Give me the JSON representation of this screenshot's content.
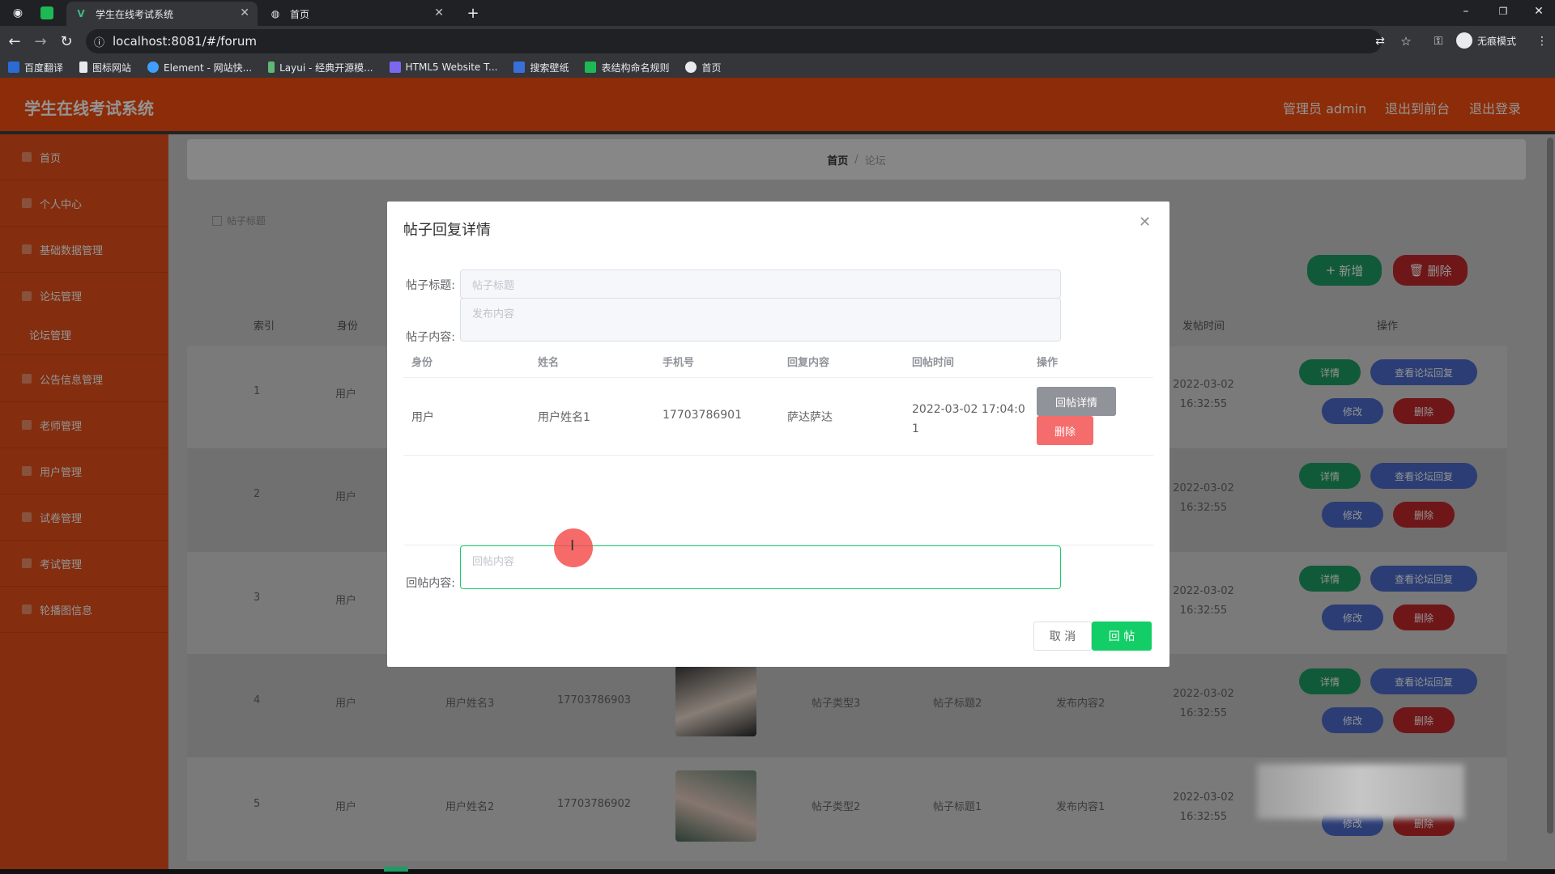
{
  "browser": {
    "tabs": [
      {
        "title": "学生在线考试系统",
        "active": true
      },
      {
        "title": "首页",
        "active": false
      }
    ],
    "url": "localhost:8081/#/forum",
    "profile_label": "无痕模式",
    "bookmarks": [
      "百度翻译",
      "图标网站",
      "Element - 网站快...",
      "Layui - 经典开源模...",
      "HTML5 Website T...",
      "搜索壁纸",
      "表结构命名规则",
      "首页"
    ]
  },
  "header": {
    "brand": "学生在线考试系统",
    "admin": "管理员 admin",
    "front": "退出到前台",
    "logout": "退出登录"
  },
  "sidebar": {
    "items": [
      "首页",
      "个人中心",
      "基础数据管理",
      "论坛管理",
      "论坛管理",
      "公告信息管理",
      "老师管理",
      "用户管理",
      "试卷管理",
      "考试管理",
      "轮播图信息"
    ]
  },
  "breadcrumb": {
    "home": "首页",
    "sep": "/",
    "current": "论坛"
  },
  "main": {
    "search_label": "帖子标题",
    "add_label": "新增",
    "delete_label": "删除",
    "columns": [
      "索引",
      "身份",
      "",
      "",
      "",
      "",
      "",
      "",
      "发帖时间",
      "操作"
    ],
    "col_time": "发帖时间",
    "col_ops": "操作",
    "col_index": "索引",
    "col_role": "身份",
    "rows": [
      {
        "index": "1",
        "role": "用户",
        "name": "",
        "phone": "",
        "type": "",
        "title": "",
        "content": "",
        "time": "2022-03-02 16:32:55"
      },
      {
        "index": "2",
        "role": "用户",
        "name": "",
        "phone": "",
        "type": "",
        "title": "",
        "content": "",
        "time": "2022-03-02 16:32:55"
      },
      {
        "index": "3",
        "role": "用户",
        "name": "",
        "phone": "",
        "type": "",
        "title": "",
        "content": "",
        "time": "2022-03-02 16:32:55"
      },
      {
        "index": "4",
        "role": "用户",
        "name": "用户姓名3",
        "phone": "17703786903",
        "type": "帖子类型3",
        "title": "帖子标题2",
        "content": "发布内容2",
        "time": "2022-03-02 16:32:55"
      },
      {
        "index": "5",
        "role": "用户",
        "name": "用户姓名2",
        "phone": "17703786902",
        "type": "帖子类型2",
        "title": "帖子标题1",
        "content": "发布内容1",
        "time": "2022-03-02 16:32:55"
      }
    ],
    "row_buttons": {
      "detail": "详情",
      "view_reply": "查看论坛回复",
      "edit": "修改",
      "del": "删除"
    }
  },
  "modal": {
    "title": "帖子回复详情",
    "title_label": "帖子标题:",
    "title_placeholder": "帖子标题",
    "content_label": "帖子内容:",
    "content_placeholder": "发布内容",
    "table": {
      "headers": [
        "身份",
        "姓名",
        "手机号",
        "回复内容",
        "回帖时间",
        "操作"
      ],
      "rows": [
        {
          "role": "用户",
          "name": "用户姓名1",
          "phone": "17703786901",
          "reply": "萨达萨达",
          "time_line1": "2022-03-02 17:04:0",
          "time_line2": "1"
        }
      ],
      "btn_detail": "回帖详情",
      "btn_delete": "删除"
    },
    "reply_label": "回帖内容:",
    "reply_placeholder": "回帖内容",
    "cancel": "取 消",
    "submit": "回 帖"
  },
  "colors": {
    "accent": "#f24d0f",
    "sidebar": "#e4501a",
    "success": "#13ce66",
    "danger": "#f56c6c"
  }
}
